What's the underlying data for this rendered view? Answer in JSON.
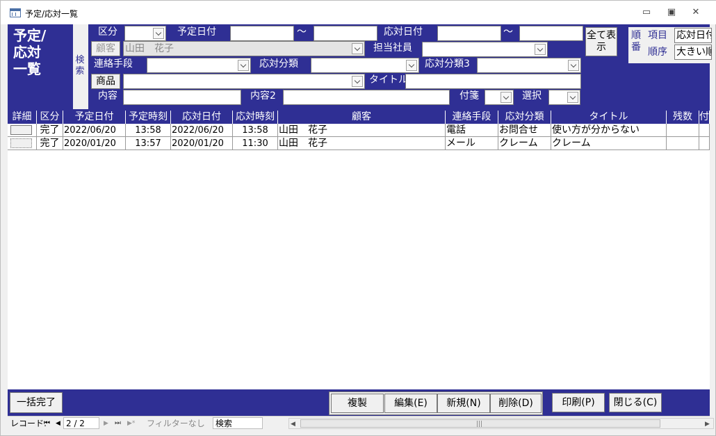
{
  "window": {
    "title": "予定/応対一覧",
    "minimize": "▭",
    "restore": "▣",
    "close": "✕"
  },
  "header": {
    "form_title_lines": [
      "予定/",
      "応対",
      "一覧"
    ],
    "search_label": "検索",
    "kubun_label": "区分",
    "yotei_date_label": "予定日付",
    "tilde": "〜",
    "outai_date_label": "応対日付",
    "show_all_button": "全て表示",
    "customer_button": "顧客",
    "customer_value": "山田　花子",
    "staff_label": "担当社員",
    "contact_method_label": "連絡手段",
    "outai_category_label": "応対分類",
    "outai_category3_label": "応対分類3",
    "product_button": "商品",
    "title_label": "タイトル",
    "content_label": "内容",
    "content2_label": "内容2",
    "sticky_label": "付箋",
    "select_label": "選択",
    "sort_label": "順番",
    "sort_item_label": "項目",
    "sort_item_value": "応対日付",
    "sort_order_label": "順序",
    "sort_order_value": "大きい順"
  },
  "table": {
    "columns": [
      "詳細",
      "区分",
      "予定日付",
      "予定時刻",
      "応対日付",
      "応対時刻",
      "顧客",
      "連絡手段",
      "応対分類",
      "タイトル",
      "残数",
      "付"
    ],
    "rows": [
      {
        "kubun": "完了",
        "yotei_date": "2022/06/20",
        "yotei_time": "13:58",
        "outai_date": "2022/06/20",
        "outai_time": "13:58",
        "customer": "山田　花子",
        "method": "電話",
        "category": "お問合せ",
        "title": "使い方が分からない",
        "remain": ""
      },
      {
        "kubun": "完了",
        "yotei_date": "2020/01/20",
        "yotei_time": "13:57",
        "outai_date": "2020/01/20",
        "outai_time": "11:30",
        "customer": "山田　花子",
        "method": "メール",
        "category": "クレーム",
        "title": "クレーム",
        "remain": ""
      }
    ]
  },
  "footer": {
    "bulk_complete": "一括完了",
    "copy": "複製",
    "edit": "編集(E)",
    "new": "新規(N)",
    "delete": "削除(D)",
    "print": "印刷(P)",
    "close": "閉じる(C)"
  },
  "nav": {
    "record_label": "レコード:",
    "first": "⏮",
    "prev": "◀",
    "position": "2 / 2",
    "next": "▶",
    "last": "⏭",
    "new": "▶*",
    "filter": "フィルターなし",
    "search": "検索",
    "scroll_left": "◀",
    "scroll_right": "▶",
    "grip": "|||"
  }
}
